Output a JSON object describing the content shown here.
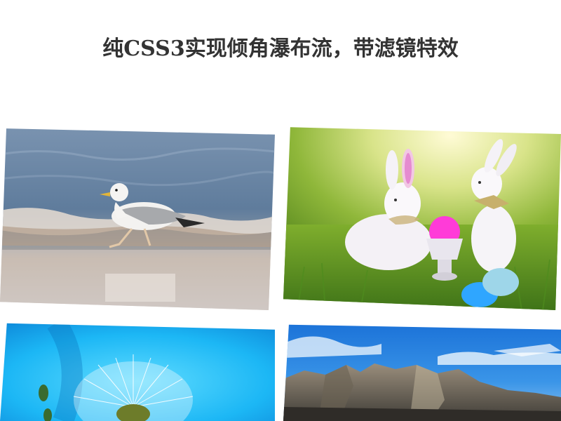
{
  "page": {
    "title": "纯CSS3实现倾角瀑布流，带滤镜特效"
  },
  "gallery": {
    "items": [
      {
        "name": "seagull-on-beach",
        "icon": "photo-seagull"
      },
      {
        "name": "easter-bunnies-on-grass",
        "icon": "photo-easter-bunnies"
      },
      {
        "name": "dandelion-blue-sky",
        "icon": "photo-dandelion"
      },
      {
        "name": "mountain-range",
        "icon": "photo-mountains"
      }
    ]
  },
  "colors": {
    "title": "#333333",
    "background": "#ffffff"
  }
}
